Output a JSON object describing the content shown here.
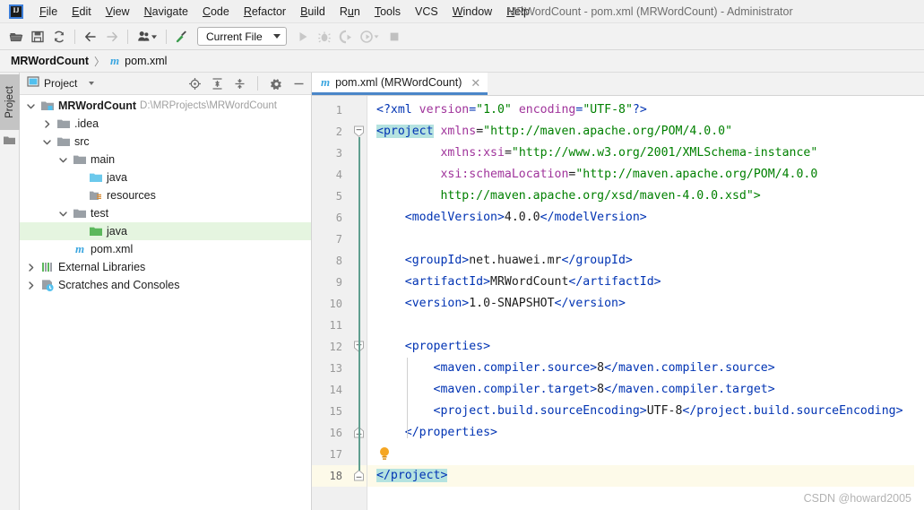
{
  "titlebar": {
    "logo_icon": "intellij-logo-icon",
    "window_title": "MRWordCount - pom.xml (MRWordCount) - Administrator",
    "menu": [
      {
        "label": "File",
        "mnemonic": "F"
      },
      {
        "label": "Edit",
        "mnemonic": "E"
      },
      {
        "label": "View",
        "mnemonic": "V"
      },
      {
        "label": "Navigate",
        "mnemonic": "N"
      },
      {
        "label": "Code",
        "mnemonic": "C"
      },
      {
        "label": "Refactor",
        "mnemonic": "R"
      },
      {
        "label": "Build",
        "mnemonic": "B"
      },
      {
        "label": "Run",
        "mnemonic": "u"
      },
      {
        "label": "Tools",
        "mnemonic": "T"
      },
      {
        "label": "VCS",
        "mnemonic": ""
      },
      {
        "label": "Window",
        "mnemonic": "W"
      },
      {
        "label": "Help",
        "mnemonic": "H"
      }
    ]
  },
  "toolbar": {
    "buttons": [
      {
        "name": "open-project-icon",
        "title": "Open"
      },
      {
        "name": "save-all-icon",
        "title": "Save All"
      },
      {
        "name": "sync-refresh-icon",
        "title": "Synchronize"
      },
      {
        "name": "back-arrow-icon",
        "title": "Back"
      },
      {
        "name": "forward-arrow-icon",
        "title": "Forward"
      },
      {
        "name": "vcs-update-icon",
        "title": "Update Project"
      },
      {
        "name": "build-hammer-icon",
        "title": "Build Project"
      }
    ],
    "run_config": {
      "label": "Current File",
      "dropdown_icon": "chevron-down-icon"
    },
    "run_buttons": [
      {
        "name": "run-icon",
        "title": "Run"
      },
      {
        "name": "debug-icon",
        "title": "Debug"
      },
      {
        "name": "run-coverage-icon",
        "title": "Run with Coverage"
      },
      {
        "name": "profiler-icon",
        "title": "Profile"
      },
      {
        "name": "stop-icon",
        "title": "Stop"
      }
    ]
  },
  "breadcrumb": {
    "project": "MRWordCount",
    "separator": "〉",
    "file_icon": "maven-m-icon",
    "file": "pom.xml"
  },
  "sidebar": {
    "vertical_tab": "Project",
    "header": {
      "title": "Project",
      "view_dropdown_icon": "chevron-down-icon",
      "actions": [
        {
          "name": "locate-file-icon",
          "title": "Select Opened File"
        },
        {
          "name": "expand-all-icon",
          "title": "Expand All"
        },
        {
          "name": "collapse-all-icon",
          "title": "Collapse All"
        },
        {
          "name": "gear-icon",
          "title": "Options"
        },
        {
          "name": "hide-icon",
          "title": "Hide"
        }
      ]
    },
    "tree": [
      {
        "label": "MRWordCount",
        "path": "D:\\MRProjects\\MRWordCount",
        "indent": 0,
        "twist": "down",
        "icon": "module-icon",
        "bold": true,
        "selected": false
      },
      {
        "label": ".idea",
        "path": "",
        "indent": 1,
        "twist": "right",
        "icon": "folder-icon",
        "bold": false,
        "selected": false
      },
      {
        "label": "src",
        "path": "",
        "indent": 1,
        "twist": "down",
        "icon": "folder-icon",
        "bold": false,
        "selected": false
      },
      {
        "label": "main",
        "path": "",
        "indent": 2,
        "twist": "down",
        "icon": "folder-icon",
        "bold": false,
        "selected": false
      },
      {
        "label": "java",
        "path": "",
        "indent": 3,
        "twist": "none",
        "icon": "source-folder-icon",
        "bold": false,
        "selected": false
      },
      {
        "label": "resources",
        "path": "",
        "indent": 3,
        "twist": "none",
        "icon": "resource-folder-icon",
        "bold": false,
        "selected": false
      },
      {
        "label": "test",
        "path": "",
        "indent": 2,
        "twist": "down",
        "icon": "folder-icon",
        "bold": false,
        "selected": false
      },
      {
        "label": "java",
        "path": "",
        "indent": 3,
        "twist": "none",
        "icon": "test-source-folder-icon",
        "bold": false,
        "selected": true
      },
      {
        "label": "pom.xml",
        "path": "",
        "indent": 2,
        "twist": "none",
        "icon": "maven-m-icon",
        "bold": false,
        "selected": false
      },
      {
        "label": "External Libraries",
        "path": "",
        "indent": 0,
        "twist": "right",
        "icon": "libraries-icon",
        "bold": false,
        "selected": false
      },
      {
        "label": "Scratches and Consoles",
        "path": "",
        "indent": 0,
        "twist": "right",
        "icon": "scratches-icon",
        "bold": false,
        "selected": false
      }
    ]
  },
  "editor": {
    "tab": {
      "icon": "maven-m-icon",
      "label": "pom.xml (MRWordCount)",
      "close_icon": "close-icon"
    },
    "current_line": 18,
    "line_numbers": [
      1,
      2,
      3,
      4,
      5,
      6,
      7,
      8,
      9,
      10,
      11,
      12,
      13,
      14,
      15,
      16,
      17,
      18
    ],
    "lines": [
      {
        "n": 1,
        "tokens": [
          {
            "t": "pi",
            "v": "<?xml "
          },
          {
            "t": "attr",
            "v": "version"
          },
          {
            "t": "pi",
            "v": "="
          },
          {
            "t": "val",
            "v": "\"1.0\""
          },
          {
            "t": "pi",
            "v": " "
          },
          {
            "t": "attr",
            "v": "encoding"
          },
          {
            "t": "pi",
            "v": "="
          },
          {
            "t": "val",
            "v": "\"UTF-8\""
          },
          {
            "t": "pi",
            "v": "?>"
          }
        ],
        "indent": 0
      },
      {
        "n": 2,
        "tokens": [
          {
            "t": "tag",
            "v": "<project",
            "hl": true
          },
          {
            "t": "txt",
            "v": " "
          },
          {
            "t": "attr",
            "v": "xmlns"
          },
          {
            "t": "txt",
            "v": "="
          },
          {
            "t": "val",
            "v": "\"http://maven.apache.org/POM/4.0.0\""
          }
        ],
        "indent": 0
      },
      {
        "n": 3,
        "tokens": [
          {
            "t": "txt",
            "v": "         "
          },
          {
            "t": "attr",
            "v": "xmlns:xsi"
          },
          {
            "t": "txt",
            "v": "="
          },
          {
            "t": "val",
            "v": "\"http://www.w3.org/2001/XMLSchema-instance\""
          }
        ],
        "indent": 0
      },
      {
        "n": 4,
        "tokens": [
          {
            "t": "txt",
            "v": "         "
          },
          {
            "t": "attr",
            "v": "xsi:schemaLocation"
          },
          {
            "t": "txt",
            "v": "="
          },
          {
            "t": "val",
            "v": "\"http://maven.apache.org/POM/4.0.0"
          }
        ],
        "indent": 0
      },
      {
        "n": 5,
        "tokens": [
          {
            "t": "txt",
            "v": "         "
          },
          {
            "t": "val",
            "v": "http://maven.apache.org/xsd/maven-4.0.0.xsd\">"
          }
        ],
        "indent": 0
      },
      {
        "n": 6,
        "tokens": [
          {
            "t": "txt",
            "v": "    "
          },
          {
            "t": "tag",
            "v": "<modelVersion>"
          },
          {
            "t": "txt",
            "v": "4.0.0"
          },
          {
            "t": "tag",
            "v": "</modelVersion>"
          }
        ],
        "indent": 1
      },
      {
        "n": 7,
        "tokens": [],
        "indent": 1
      },
      {
        "n": 8,
        "tokens": [
          {
            "t": "txt",
            "v": "    "
          },
          {
            "t": "tag",
            "v": "<groupId>"
          },
          {
            "t": "txt",
            "v": "net.huawei.mr"
          },
          {
            "t": "tag",
            "v": "</groupId>"
          }
        ],
        "indent": 1
      },
      {
        "n": 9,
        "tokens": [
          {
            "t": "txt",
            "v": "    "
          },
          {
            "t": "tag",
            "v": "<artifactId>"
          },
          {
            "t": "txt",
            "v": "MRWordCount"
          },
          {
            "t": "tag",
            "v": "</artifactId>"
          }
        ],
        "indent": 1
      },
      {
        "n": 10,
        "tokens": [
          {
            "t": "txt",
            "v": "    "
          },
          {
            "t": "tag",
            "v": "<version>"
          },
          {
            "t": "txt",
            "v": "1.0-SNAPSHOT"
          },
          {
            "t": "tag",
            "v": "</version>"
          }
        ],
        "indent": 1
      },
      {
        "n": 11,
        "tokens": [],
        "indent": 1
      },
      {
        "n": 12,
        "tokens": [
          {
            "t": "txt",
            "v": "    "
          },
          {
            "t": "tag",
            "v": "<properties>"
          }
        ],
        "indent": 1
      },
      {
        "n": 13,
        "tokens": [
          {
            "t": "txt",
            "v": "        "
          },
          {
            "t": "tag",
            "v": "<maven.compiler.source>"
          },
          {
            "t": "txt",
            "v": "8"
          },
          {
            "t": "tag",
            "v": "</maven.compiler.source>"
          }
        ],
        "indent": 2
      },
      {
        "n": 14,
        "tokens": [
          {
            "t": "txt",
            "v": "        "
          },
          {
            "t": "tag",
            "v": "<maven.compiler.target>"
          },
          {
            "t": "txt",
            "v": "8"
          },
          {
            "t": "tag",
            "v": "</maven.compiler.target>"
          }
        ],
        "indent": 2
      },
      {
        "n": 15,
        "tokens": [
          {
            "t": "txt",
            "v": "        "
          },
          {
            "t": "tag",
            "v": "<project.build.sourceEncoding>"
          },
          {
            "t": "txt",
            "v": "UTF-8"
          },
          {
            "t": "tag",
            "v": "</project.build.sourceEncoding>"
          }
        ],
        "indent": 2
      },
      {
        "n": 16,
        "tokens": [
          {
            "t": "txt",
            "v": "    "
          },
          {
            "t": "tag",
            "v": "</properties>"
          }
        ],
        "indent": 1
      },
      {
        "n": 17,
        "tokens": [],
        "indent": 1,
        "bulb": true
      },
      {
        "n": 18,
        "tokens": [
          {
            "t": "tag",
            "v": "</project>",
            "hl": true
          }
        ],
        "indent": 0,
        "current": true
      }
    ],
    "folds": [
      {
        "line": 2,
        "state": "expanded"
      },
      {
        "line": 12,
        "state": "expanded"
      },
      {
        "line": 16,
        "state": "end"
      },
      {
        "line": 18,
        "state": "end"
      }
    ]
  },
  "watermark": "CSDN @howard2005",
  "colors": {
    "accent": "#4a86c8",
    "tag": "#0033b3",
    "attribute": "#a0349b",
    "value": "#008000",
    "selection": "#b5e3e0",
    "current_line": "#fdfae9",
    "tree_selection": "#e5f5e0"
  }
}
